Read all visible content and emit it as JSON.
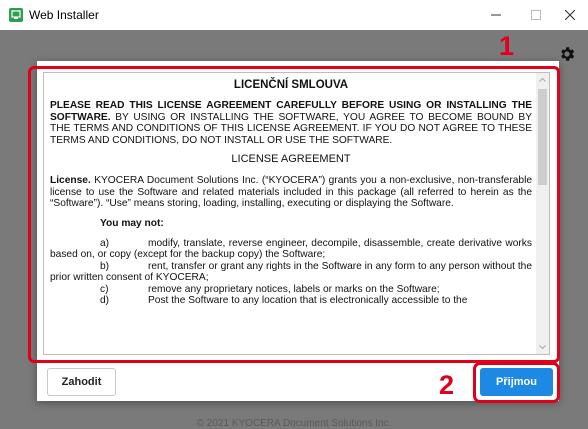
{
  "window": {
    "title": "Web Installer",
    "icon": "web-installer-app-icon",
    "controls": [
      "minimize-icon",
      "maximize-icon",
      "close-icon"
    ]
  },
  "toolbar": {
    "settings_icon": "gear-icon"
  },
  "license": {
    "heading": "LICENČNÍ SMLOUVA",
    "intro_bold": "PLEASE READ THIS LICENSE AGREEMENT CAREFULLY BEFORE USING OR INSTALLING THE SOFTWARE.",
    "intro_rest": " BY USING OR INSTALLING THE SOFTWARE, YOU AGREE TO BECOME BOUND BY THE TERMS AND CONDITIONS OF THIS LICENSE AGREEMENT. IF YOU DO NOT AGREE TO THESE TERMS AND CONDITIONS, DO NOT INSTALL OR USE THE SOFTWARE.",
    "subheading": "LICENSE AGREEMENT",
    "license_label": "License.",
    "license_text": " KYOCERA Document Solutions Inc. (“KYOCERA”) grants you a non-exclusive, non-transferable license to use the Software and related materials included in this package (all referred to herein as the “Software”). “Use” means storing, loading, installing, executing or displaying the Software.",
    "may_not_label": "You may not:",
    "items": [
      {
        "num": "a)",
        "text": "modify, translate, reverse engineer, decompile, disassemble, create derivative works based on, or copy (except for the backup copy) the Software;"
      },
      {
        "num": "b)",
        "text": "rent, transfer or grant any rights in the Software in any form to any person without the prior written consent of KYOCERA;"
      },
      {
        "num": "c)",
        "text": "remove any proprietary notices, labels or marks on the Software;"
      },
      {
        "num": "d)",
        "text": "Post the Software to any location that is electronically accessible to the"
      }
    ]
  },
  "buttons": {
    "decline": "Zahodit",
    "accept": "Přijmou"
  },
  "callouts": {
    "one": "1",
    "two": "2"
  },
  "footer": {
    "copyright": "© 2021 KYOCERA Document Solutions Inc."
  },
  "colors": {
    "accent": "#1e88e5",
    "highlight": "#e0001b",
    "app_icon": "#2e9e4f"
  }
}
